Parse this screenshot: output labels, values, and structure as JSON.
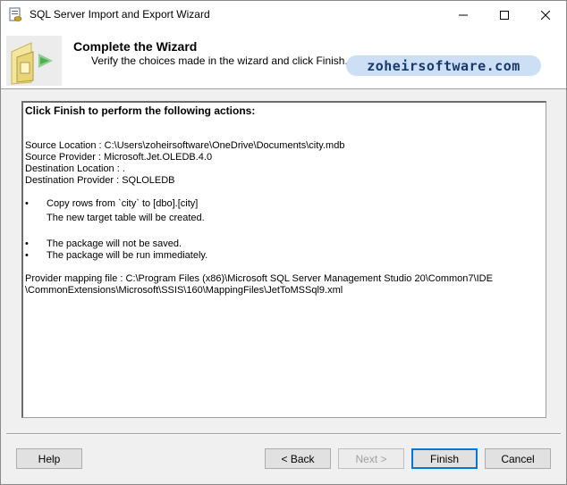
{
  "window": {
    "title": "SQL Server Import and Export Wizard"
  },
  "header": {
    "title": "Complete the Wizard",
    "subtitle": "Verify the choices made in the wizard and click Finish.",
    "watermark": "zoheirsoftware.com"
  },
  "report": {
    "heading": "Click Finish to perform the following actions:",
    "source_location": "Source Location : C:\\Users\\zoheirsoftware\\OneDrive\\Documents\\city.mdb",
    "source_provider": "Source Provider : Microsoft.Jet.OLEDB.4.0",
    "destination_location": "Destination Location : .",
    "destination_provider": "Destination Provider : SQLOLEDB",
    "copy_rows": "Copy rows from `city` to [dbo].[city]",
    "new_table": "The new target table will be created.",
    "not_saved": "The package will not be saved.",
    "run_immediately": "The package will be run immediately.",
    "mapping_line1": "Provider mapping file : C:\\Program Files (x86)\\Microsoft SQL Server Management Studio 20\\Common7\\IDE",
    "mapping_line2": "\\CommonExtensions\\Microsoft\\SSIS\\160\\MappingFiles\\JetToMSSql9.xml",
    "bullet_char": "•"
  },
  "buttons": {
    "help": "Help",
    "back": "< Back",
    "next": "Next >",
    "finish": "Finish",
    "cancel": "Cancel"
  }
}
